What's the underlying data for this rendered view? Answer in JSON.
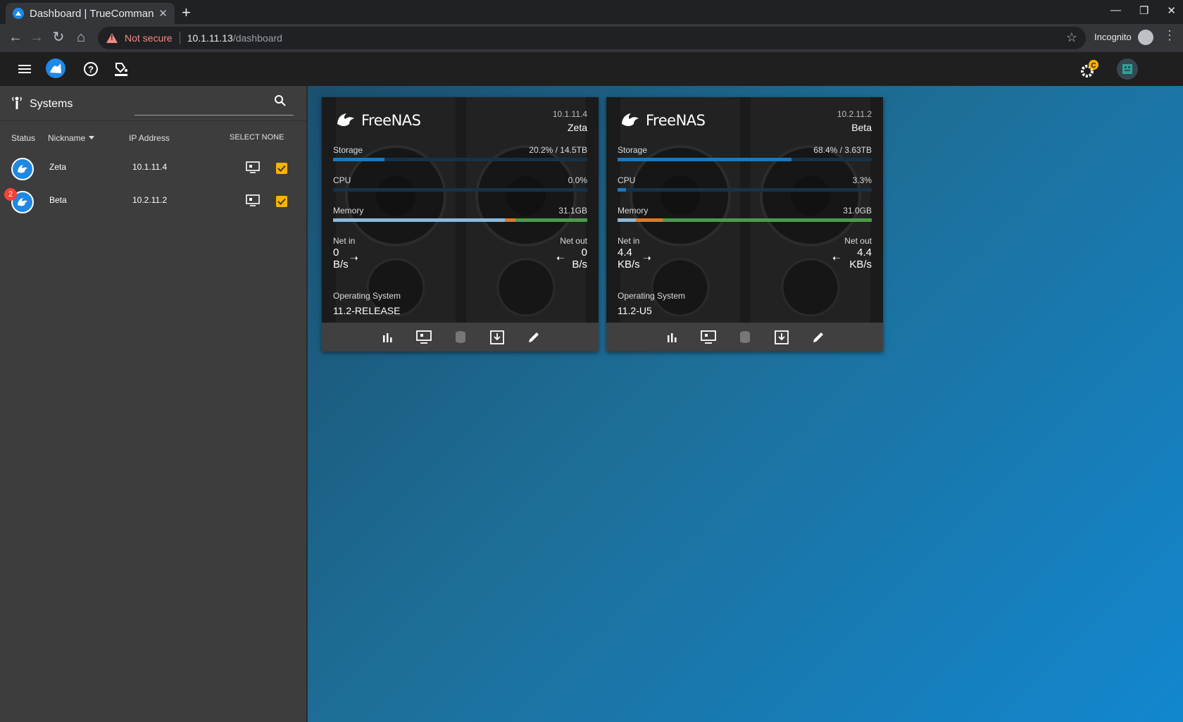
{
  "browser": {
    "tab_title": "Dashboard | TrueComman",
    "tab_close": "✕",
    "new_tab": "+",
    "security_label": "Not secure",
    "url_host": "10.1.11.13",
    "url_path": "/dashboard",
    "incognito_label": "Incognito"
  },
  "sidebar": {
    "title": "Systems",
    "search_placeholder": "",
    "columns": {
      "status": "Status",
      "nickname": "Nickname",
      "ip": "IP Address",
      "select_none": "SELECT NONE"
    },
    "rows": [
      {
        "nickname": "Zeta",
        "ip": "10.1.11.4",
        "badge": "",
        "checked": true
      },
      {
        "nickname": "Beta",
        "ip": "10.2.11.2",
        "badge": "2",
        "checked": true
      }
    ]
  },
  "cards": [
    {
      "brand": "FreeNAS",
      "ip": "10.1.11.4",
      "name": "Zeta",
      "storage_label": "Storage",
      "storage_value": "20.2% / 14.5TB",
      "storage_pct": 20.2,
      "cpu_label": "CPU",
      "cpu_value": "0.0%",
      "cpu_pct": 0.0,
      "memory_label": "Memory",
      "memory_value": "31.1GB",
      "net_in_label": "Net in",
      "net_in_num": "0",
      "net_in_unit": "B/s",
      "net_out_label": "Net out",
      "net_out_num": "0",
      "net_out_unit": "B/s",
      "os_label": "Operating System",
      "os_value": "11.2-RELEASE"
    },
    {
      "brand": "FreeNAS",
      "ip": "10.2.11.2",
      "name": "Beta",
      "storage_label": "Storage",
      "storage_value": "68.4% / 3.63TB",
      "storage_pct": 68.4,
      "cpu_label": "CPU",
      "cpu_value": "3.3%",
      "cpu_pct": 3.3,
      "memory_label": "Memory",
      "memory_value": "31.0GB",
      "net_in_label": "Net in",
      "net_in_num": "4.4",
      "net_in_unit": "KB/s",
      "net_out_label": "Net out",
      "net_out_num": "4.4",
      "net_out_unit": "KB/s",
      "os_label": "Operating System",
      "os_value": "11.2-U5"
    }
  ],
  "colors": {
    "accent": "#1e88e5",
    "checkbox": "#f9b300",
    "badge": "#f44336",
    "mem_blue": "#8bb8d8",
    "mem_orange": "#d97a2b",
    "mem_green": "#4c9a4c"
  }
}
